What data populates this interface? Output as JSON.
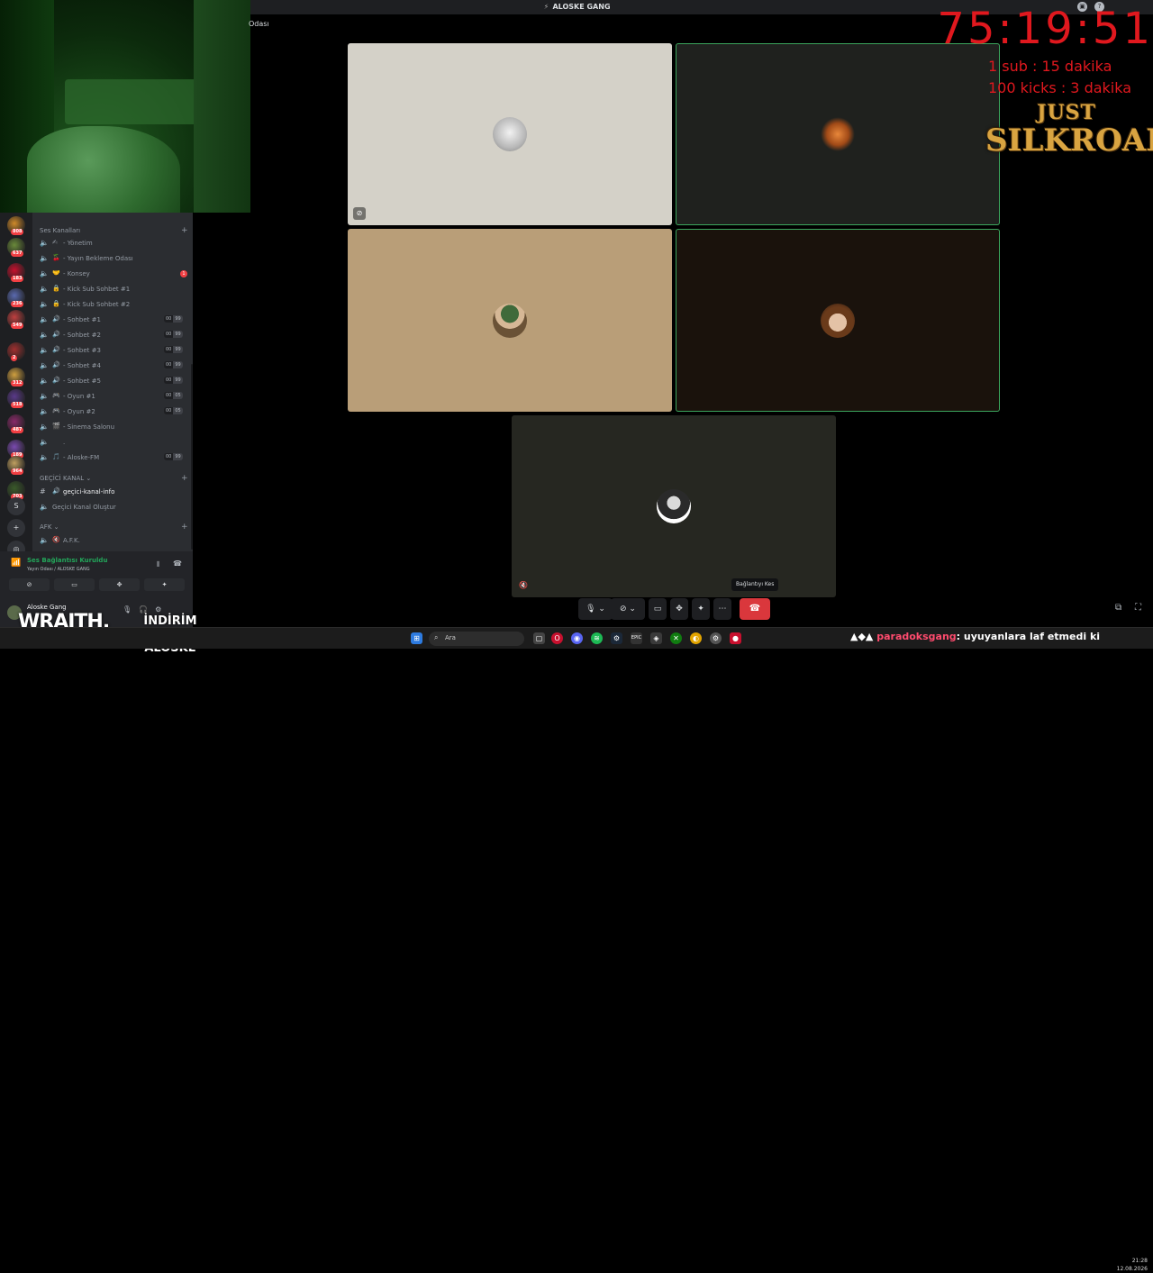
{
  "window": {
    "title": "ALOSKE GANG"
  },
  "breadcrumb": "Odası",
  "overlay": {
    "timer": "75:19:51",
    "rate_sub": "1 sub : 15 dakika",
    "rate_kicks": "100 kicks : 3 dakika",
    "logo_line1": "JUST",
    "logo_line2": "SILKROAD",
    "sponsor_brand": "WRAITH.",
    "discount_label": "İNDİRİM KODU:",
    "discount_code": "\"ALOSKE\""
  },
  "servers": {
    "badges": [
      "808",
      "637",
      "183",
      "236",
      "549",
      "2",
      "312",
      "518",
      "487",
      "189",
      "964",
      "703"
    ],
    "letter_button": "S",
    "add_icon": "plus-icon",
    "discover_icon": "compass-icon"
  },
  "sections": {
    "voice": "Ses Kanalları",
    "temp": "GEÇİCİ KANAL",
    "afk": "AFK"
  },
  "channels": [
    {
      "name": "Yönetim",
      "emoji": "✍"
    },
    {
      "name": "Yayın Bekleme Odası",
      "emoji": "🍒"
    },
    {
      "name": "Konsey",
      "emoji": "🤝",
      "mention": "1"
    },
    {
      "name": "Kick Sub Sohbet #1",
      "emoji": "🔒"
    },
    {
      "name": "Kick Sub Sohbet #2",
      "emoji": "🔒"
    },
    {
      "name": "Sohbet #1",
      "emoji": "🔊",
      "count": [
        "00",
        "99"
      ]
    },
    {
      "name": "Sohbet #2",
      "emoji": "🔊",
      "count": [
        "00",
        "99"
      ]
    },
    {
      "name": "Sohbet #3",
      "emoji": "🔊",
      "count": [
        "00",
        "99"
      ]
    },
    {
      "name": "Sohbet #4",
      "emoji": "🔊",
      "count": [
        "00",
        "99"
      ]
    },
    {
      "name": "Sohbet #5",
      "emoji": "🔊",
      "count": [
        "00",
        "99"
      ]
    },
    {
      "name": "Oyun #1",
      "emoji": "🎮",
      "count": [
        "00",
        "05"
      ]
    },
    {
      "name": "Oyun #2",
      "emoji": "🎮",
      "count": [
        "00",
        "05"
      ]
    },
    {
      "name": "Sinema Salonu",
      "emoji": "🎬"
    },
    {
      "name": ".",
      "emoji": ""
    },
    {
      "name": "Aloske-FM",
      "emoji": "🎵",
      "count": [
        "00",
        "99"
      ]
    }
  ],
  "temp_channels": [
    {
      "name": "geçici-kanal-info"
    },
    {
      "name": "Geçici Kanal Oluştur"
    }
  ],
  "afk_channels": [
    {
      "name": "A.F.K."
    }
  ],
  "voice_panel": {
    "status": "Ses Bağlantısı Kuruldu",
    "channel": "Yayın Odası / ALOSKE GANG"
  },
  "user_panel": {
    "username": "Aloske Gang"
  },
  "call": {
    "hangup_tooltip": "Bağlantıyı Kes"
  },
  "taskbar": {
    "search_placeholder": "Ara",
    "time": "21:28",
    "date": "12.08.2026"
  },
  "chat_overlay": {
    "user": "paradoksgang",
    "message": ": uyuyanlara laf etmedi ki"
  },
  "colors": {
    "timer": "#e0181e",
    "speaking_border": "#3ba55c",
    "hangup": "#da373c",
    "connected": "#23a55a"
  }
}
